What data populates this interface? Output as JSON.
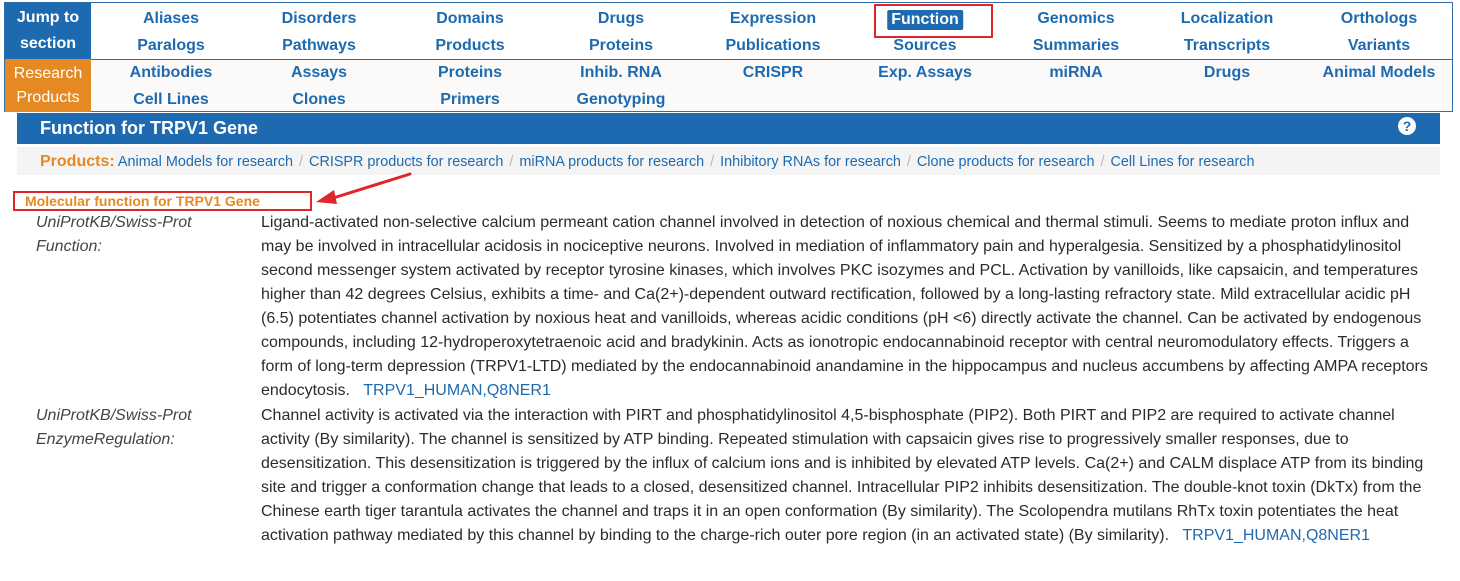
{
  "nav": {
    "jump_label_line1": "Jump to",
    "jump_label_line2": "section",
    "research_label_line1": "Research",
    "research_label_line2": "Products",
    "jump_row1": [
      "Aliases",
      "Disorders",
      "Domains",
      "Drugs",
      "Expression",
      "Function",
      "Genomics",
      "Localization",
      "Orthologs"
    ],
    "jump_row2": [
      "Paralogs",
      "Pathways",
      "Products",
      "Proteins",
      "Publications",
      "Sources",
      "Summaries",
      "Transcripts",
      "Variants"
    ],
    "research_row1": [
      "Antibodies",
      "Assays",
      "Proteins",
      "Inhib. RNA",
      "CRISPR",
      "Exp. Assays",
      "miRNA",
      "Drugs",
      "Animal Models"
    ],
    "research_row2": [
      "Cell Lines",
      "Clones",
      "Primers",
      "Genotyping"
    ],
    "active": "Function"
  },
  "section": {
    "title": "Function for TRPV1 Gene",
    "help_icon": "?"
  },
  "products": {
    "label": "Products:",
    "links": [
      "Animal Models for research",
      "CRISPR products for research",
      "miRNA products for research",
      "Inhibitory RNAs for research",
      "Clone products for research",
      "Cell Lines for research"
    ],
    "separator": "/"
  },
  "molecular_function": {
    "heading": "Molecular function for TRPV1 Gene",
    "rows": [
      {
        "label_line1": "UniProtKB/Swiss-Prot",
        "label_line2": "Function:",
        "text": "Ligand-activated non-selective calcium permeant cation channel involved in detection of noxious chemical and thermal stimuli. Seems to mediate proton influx and may be involved in intracellular acidosis in nociceptive neurons. Involved in mediation of inflammatory pain and hyperalgesia. Sensitized by a phosphatidylinositol second messenger system activated by receptor tyrosine kinases, which involves PKC isozymes and PCL. Activation by vanilloids, like capsaicin, and temperatures higher than 42 degrees Celsius, exhibits a time- and Ca(2+)-dependent outward rectification, followed by a long-lasting refractory state. Mild extracellular acidic pH (6.5) potentiates channel activation by noxious heat and vanilloids, whereas acidic conditions (pH <6) directly activate the channel. Can be activated by endogenous compounds, including 12-hydroperoxytetraenoic acid and bradykinin. Acts as ionotropic endocannabinoid receptor with central neuromodulatory effects. Triggers a form of long-term depression (TRPV1-LTD) mediated by the endocannabinoid anandamine in the hippocampus and nucleus accumbens by affecting AMPA receptors endocytosis.",
        "ref": "TRPV1_HUMAN,Q8NER1"
      },
      {
        "label_line1": "UniProtKB/Swiss-Prot",
        "label_line2": "EnzymeRegulation:",
        "text": "Channel activity is activated via the interaction with PIRT and phosphatidylinositol 4,5-bisphosphate (PIP2). Both PIRT and PIP2 are required to activate channel activity (By similarity). The channel is sensitized by ATP binding. Repeated stimulation with capsaicin gives rise to progressively smaller responses, due to desensitization. This desensitization is triggered by the influx of calcium ions and is inhibited by elevated ATP levels. Ca(2+) and CALM displace ATP from its binding site and trigger a conformation change that leads to a closed, desensitized channel. Intracellular PIP2 inhibits desensitization. The double-knot toxin (DkTx) from the Chinese earth tiger tarantula activates the channel and traps it in an open conformation (By similarity). The Scolopendra mutilans RhTx toxin potentiates the heat activation pathway mediated by this channel by binding to the charge-rich outer pore region (in an activated state) (By similarity).",
        "ref": "TRPV1_HUMAN,Q8NER1"
      }
    ]
  },
  "colors": {
    "brand_blue": "#1e6ab0",
    "accent_orange": "#e58a22",
    "annotation_red": "#e0252b"
  }
}
